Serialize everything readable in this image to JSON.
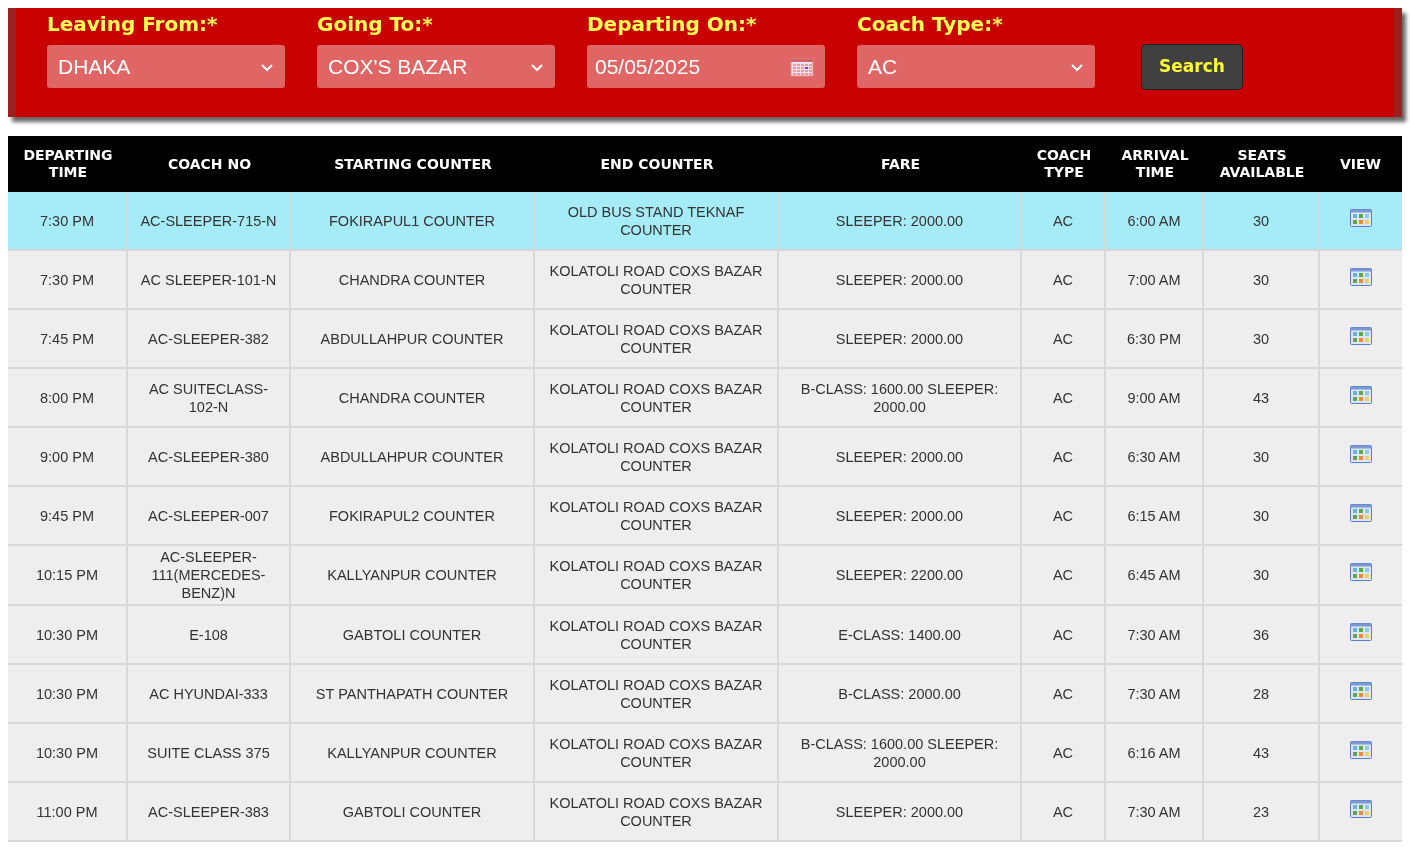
{
  "search_form": {
    "fields": [
      {
        "kind": "select",
        "label": "Leaving From:*",
        "value": "DHAKA"
      },
      {
        "kind": "select",
        "label": "Going To:*",
        "value": "COX'S BAZAR"
      },
      {
        "kind": "date",
        "label": "Departing On:*",
        "value": "05/05/2025"
      },
      {
        "kind": "select",
        "label": "Coach Type:*",
        "value": "AC"
      }
    ],
    "button": "Search"
  },
  "table": {
    "columns": [
      "DEPARTING TIME",
      "COACH NO",
      "STARTING COUNTER",
      "END COUNTER",
      "FARE",
      "COACH TYPE",
      "ARRIVAL TIME",
      "SEATS AVAILABLE",
      "VIEW"
    ],
    "rows": [
      {
        "selected": true,
        "cells": [
          "7:30 PM",
          "AC-SLEEPER-715-N",
          "FOKIRAPUL1 COUNTER",
          "OLD BUS STAND TEKNAF COUNTER",
          "SLEEPER: 2000.00",
          "AC",
          "6:00 AM",
          "30"
        ]
      },
      {
        "selected": false,
        "cells": [
          "7:30 PM",
          "AC SLEEPER-101-N",
          "CHANDRA COUNTER",
          "KOLATOLI ROAD COXS BAZAR COUNTER",
          "SLEEPER: 2000.00",
          "AC",
          "7:00 AM",
          "30"
        ]
      },
      {
        "selected": false,
        "cells": [
          "7:45 PM",
          "AC-SLEEPER-382",
          "ABDULLAHPUR COUNTER",
          "KOLATOLI ROAD COXS BAZAR COUNTER",
          "SLEEPER: 2000.00",
          "AC",
          "6:30 PM",
          "30"
        ]
      },
      {
        "selected": false,
        "cells": [
          "8:00 PM",
          "AC SUITECLASS-102-N",
          "CHANDRA COUNTER",
          "KOLATOLI ROAD COXS BAZAR COUNTER",
          "B-CLASS: 1600.00 SLEEPER: 2000.00",
          "AC",
          "9:00 AM",
          "43"
        ]
      },
      {
        "selected": false,
        "cells": [
          "9:00 PM",
          "AC-SLEEPER-380",
          "ABDULLAHPUR COUNTER",
          "KOLATOLI ROAD COXS BAZAR COUNTER",
          "SLEEPER: 2000.00",
          "AC",
          "6:30 AM",
          "30"
        ]
      },
      {
        "selected": false,
        "cells": [
          "9:45 PM",
          "AC-SLEEPER-007",
          "FOKIRAPUL2 COUNTER",
          "KOLATOLI ROAD COXS BAZAR COUNTER",
          "SLEEPER: 2000.00",
          "AC",
          "6:15 AM",
          "30"
        ]
      },
      {
        "selected": false,
        "cells": [
          "10:15 PM",
          "AC-SLEEPER-111(MERCEDES-BENZ)N",
          "KALLYANPUR COUNTER",
          "KOLATOLI ROAD COXS BAZAR COUNTER",
          "SLEEPER: 2200.00",
          "AC",
          "6:45 AM",
          "30"
        ]
      },
      {
        "selected": false,
        "cells": [
          "10:30 PM",
          "E-108",
          "GABTOLI COUNTER",
          "KOLATOLI ROAD COXS BAZAR COUNTER",
          "E-CLASS: 1400.00",
          "AC",
          "7:30 AM",
          "36"
        ]
      },
      {
        "selected": false,
        "cells": [
          "10:30 PM",
          "AC HYUNDAI-333",
          "ST PANTHAPATH COUNTER",
          "KOLATOLI ROAD COXS BAZAR COUNTER",
          "B-CLASS: 2000.00",
          "AC",
          "7:30 AM",
          "28"
        ]
      },
      {
        "selected": false,
        "cells": [
          "10:30 PM",
          "SUITE CLASS 375",
          "KALLYANPUR COUNTER",
          "KOLATOLI ROAD COXS BAZAR COUNTER",
          "B-CLASS: 1600.00 SLEEPER: 2000.00",
          "AC",
          "6:16 AM",
          "43"
        ]
      },
      {
        "selected": false,
        "cells": [
          "11:00 PM",
          "AC-SLEEPER-383",
          "GABTOLI COUNTER",
          "KOLATOLI ROAD COXS BAZAR COUNTER",
          "SLEEPER: 2000.00",
          "AC",
          "7:30 AM",
          "23"
        ]
      }
    ]
  }
}
